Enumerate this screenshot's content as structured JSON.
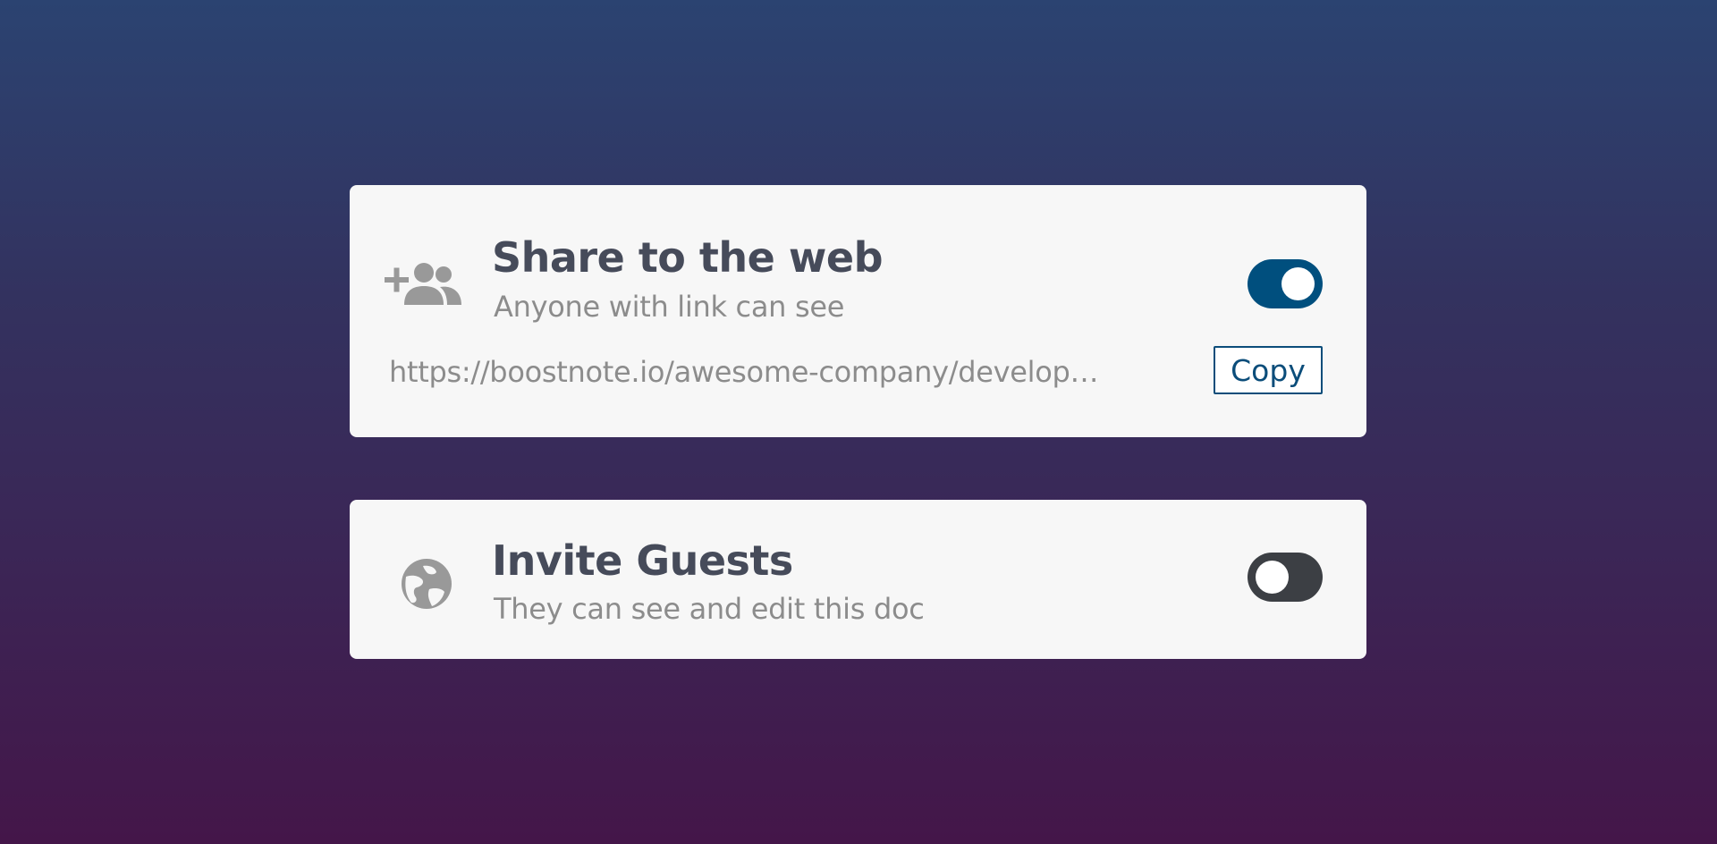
{
  "share": {
    "title": "Share to the web",
    "subtitle": "Anyone with link can see",
    "enabled": true,
    "link": "https://boostnote.io/awesome-company/development-docs",
    "copy_label": "Copy",
    "icon": "add-people-icon"
  },
  "guests": {
    "title": "Invite Guests",
    "subtitle": "They can see and edit this doc",
    "enabled": false,
    "icon": "globe-icon"
  },
  "colors": {
    "accent": "#004f7e",
    "toggle_off": "#3c3f44",
    "card_bg": "#f7f7f7",
    "title_text": "#464b5a",
    "muted_text": "#8c8c8c",
    "icon_gray": "#999999"
  }
}
